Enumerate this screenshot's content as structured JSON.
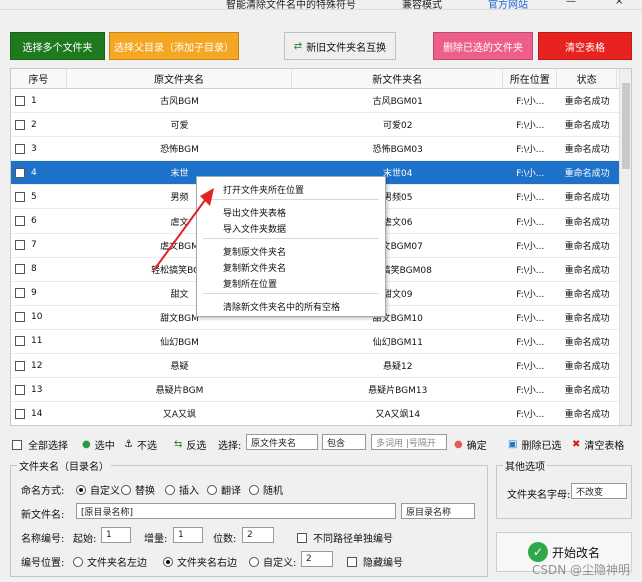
{
  "top_strip": {
    "item1": "智能清除文件名中的特殊符号",
    "item2": "兼容模式",
    "item3": "官方网站"
  },
  "toolbar": {
    "select_multi": "选择多个文件夹",
    "select_parent": "选择父目录（添加子目录）",
    "swap": "新旧文件夹名互换",
    "delete_selected": "删除已选的文件夹",
    "clear": "清空表格",
    "colors": {
      "green": "#1f7a1f",
      "orange": "#f5a623",
      "pink": "#ee5e8b",
      "red": "#e82121"
    }
  },
  "table": {
    "headers": [
      "序号",
      "原文件夹名",
      "新文件夹名",
      "所在位置",
      "状态"
    ],
    "rows": [
      {
        "n": "1",
        "old": "古风BGM",
        "new": "古风BGM01",
        "loc": "F:\\小...",
        "st": "重命名成功"
      },
      {
        "n": "2",
        "old": "可爱",
        "new": "可爱02",
        "loc": "F:\\小...",
        "st": "重命名成功"
      },
      {
        "n": "3",
        "old": "恐怖BGM",
        "new": "恐怖BGM03",
        "loc": "F:\\小...",
        "st": "重命名成功"
      },
      {
        "n": "4",
        "old": "末世",
        "new": "末世04",
        "loc": "F:\\小...",
        "st": "重命名成功"
      },
      {
        "n": "5",
        "old": "男频",
        "new": "男频05",
        "loc": "F:\\小...",
        "st": "重命名成功"
      },
      {
        "n": "6",
        "old": "虐文",
        "new": "虐文06",
        "loc": "F:\\小...",
        "st": "重命名成功"
      },
      {
        "n": "7",
        "old": "虐文BGM",
        "new": "虐文BGM07",
        "loc": "F:\\小...",
        "st": "重命名成功"
      },
      {
        "n": "8",
        "old": "轻松搞笑BGM",
        "new": "轻松搞笑BGM08",
        "loc": "F:\\小...",
        "st": "重命名成功"
      },
      {
        "n": "9",
        "old": "甜文",
        "new": "甜文09",
        "loc": "F:\\小...",
        "st": "重命名成功"
      },
      {
        "n": "10",
        "old": "甜文BGM",
        "new": "甜文BGM10",
        "loc": "F:\\小...",
        "st": "重命名成功"
      },
      {
        "n": "11",
        "old": "仙幻BGM",
        "new": "仙幻BGM11",
        "loc": "F:\\小...",
        "st": "重命名成功"
      },
      {
        "n": "12",
        "old": "悬疑",
        "new": "悬疑12",
        "loc": "F:\\小...",
        "st": "重命名成功"
      },
      {
        "n": "13",
        "old": "悬疑片BGM",
        "new": "悬疑片BGM13",
        "loc": "F:\\小...",
        "st": "重命名成功"
      },
      {
        "n": "14",
        "old": "又A又飒",
        "new": "又A又飒14",
        "loc": "F:\\小...",
        "st": "重命名成功"
      }
    ]
  },
  "context_menu": {
    "items": [
      "打开文件夹所在位置",
      "导出文件夹表格",
      "导入文件夹数据",
      "复制原文件夹名",
      "复制新文件夹名",
      "复制所在位置",
      "清除新文件夹名中的所有空格"
    ]
  },
  "bottom_bar": {
    "select_all": "全部选择",
    "select": "选中",
    "unselect": "不选",
    "invert": "反选",
    "choose": "选择:",
    "field": "原文件夹名",
    "match": "包含",
    "placeholder": "多词用 |号隔开",
    "confirm": "确定",
    "delete_selected": "删除已选",
    "clear_table": "清空表格"
  },
  "folder_name": {
    "group_label": "文件夹名（目录名）",
    "mode_label": "命名方式:",
    "modes": [
      "自定义",
      "替换",
      "插入",
      "翻译",
      "随机"
    ],
    "new_label": "新文件名:",
    "new_value": "[原目录名称]",
    "new_select": "原目录名称",
    "numbering_label": "名称编号:",
    "start_label": "起始:",
    "start": "1",
    "inc_label": "增量:",
    "inc": "1",
    "digits_label": "位数:",
    "digits": "2",
    "unique_label": "不同路径单独编号",
    "pos_label": "编号位置:",
    "pos_left": "文件夹名左边",
    "pos_right": "文件夹名右边",
    "pos_custom": "自定义:",
    "custom_value": "2",
    "hide_label": "隐藏编号"
  },
  "other": {
    "group_label": "其他选项",
    "case_label": "文件夹名字母:",
    "case_value": "不改变",
    "start_rename": "开始改名"
  },
  "watermark": "CSDN @尘隐神明"
}
